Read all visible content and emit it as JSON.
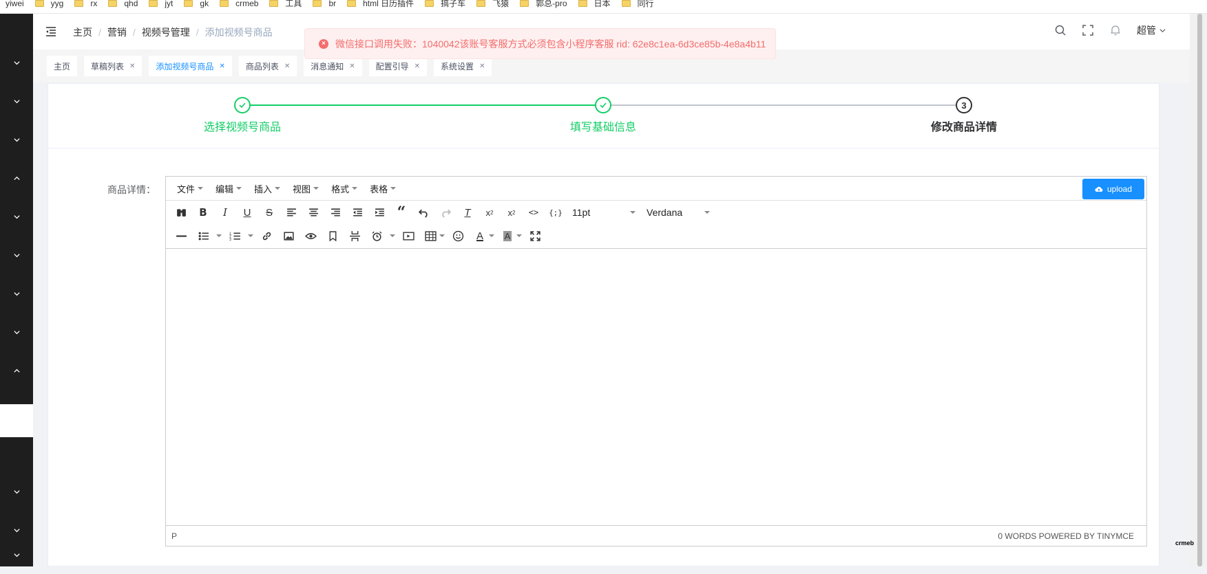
{
  "bookmarks": [
    "yiwei",
    "yyg",
    "rx",
    "qhd",
    "jyt",
    "gk",
    "crmeb",
    "工具",
    "br",
    "html 日历插件",
    "搞子车",
    "飞猿",
    "郭总-pro",
    "日本",
    "同行"
  ],
  "header": {
    "breadcrumb": [
      "主页",
      "营销",
      "视频号管理",
      "添加视频号商品"
    ],
    "user": "超管"
  },
  "toast": {
    "message": "微信接口调用失败：1040042该账号客服方式必须包含小程序客服 rid: 62e8c1ea-6d3ce85b-4e8a4b11"
  },
  "tags": [
    {
      "label": "主页",
      "closable": false
    },
    {
      "label": "草稿列表",
      "closable": true
    },
    {
      "label": "添加视频号商品",
      "closable": true,
      "active": true
    },
    {
      "label": "商品列表",
      "closable": true
    },
    {
      "label": "消息通知",
      "closable": true
    },
    {
      "label": "配置引导",
      "closable": true
    },
    {
      "label": "系统设置",
      "closable": true
    }
  ],
  "steps": [
    {
      "title": "选择视频号商品",
      "status": "done"
    },
    {
      "title": "填写基础信息",
      "status": "done"
    },
    {
      "title": "修改商品详情",
      "number": "3",
      "status": "current"
    }
  ],
  "form": {
    "detail_label": "商品详情："
  },
  "editor": {
    "menus": [
      "文件",
      "编辑",
      "插入",
      "视图",
      "格式",
      "表格"
    ],
    "upload_label": "upload",
    "font_size": "11pt",
    "font_family": "Verdana",
    "status_path": "P",
    "status_right": "0 WORDS POWERED BY TINYMCE"
  },
  "watermark": "crmeb",
  "colors": {
    "primary": "#1890ff",
    "success": "#13ce66",
    "error": "#f56c6c",
    "sidebar": "#1e1e1e"
  }
}
